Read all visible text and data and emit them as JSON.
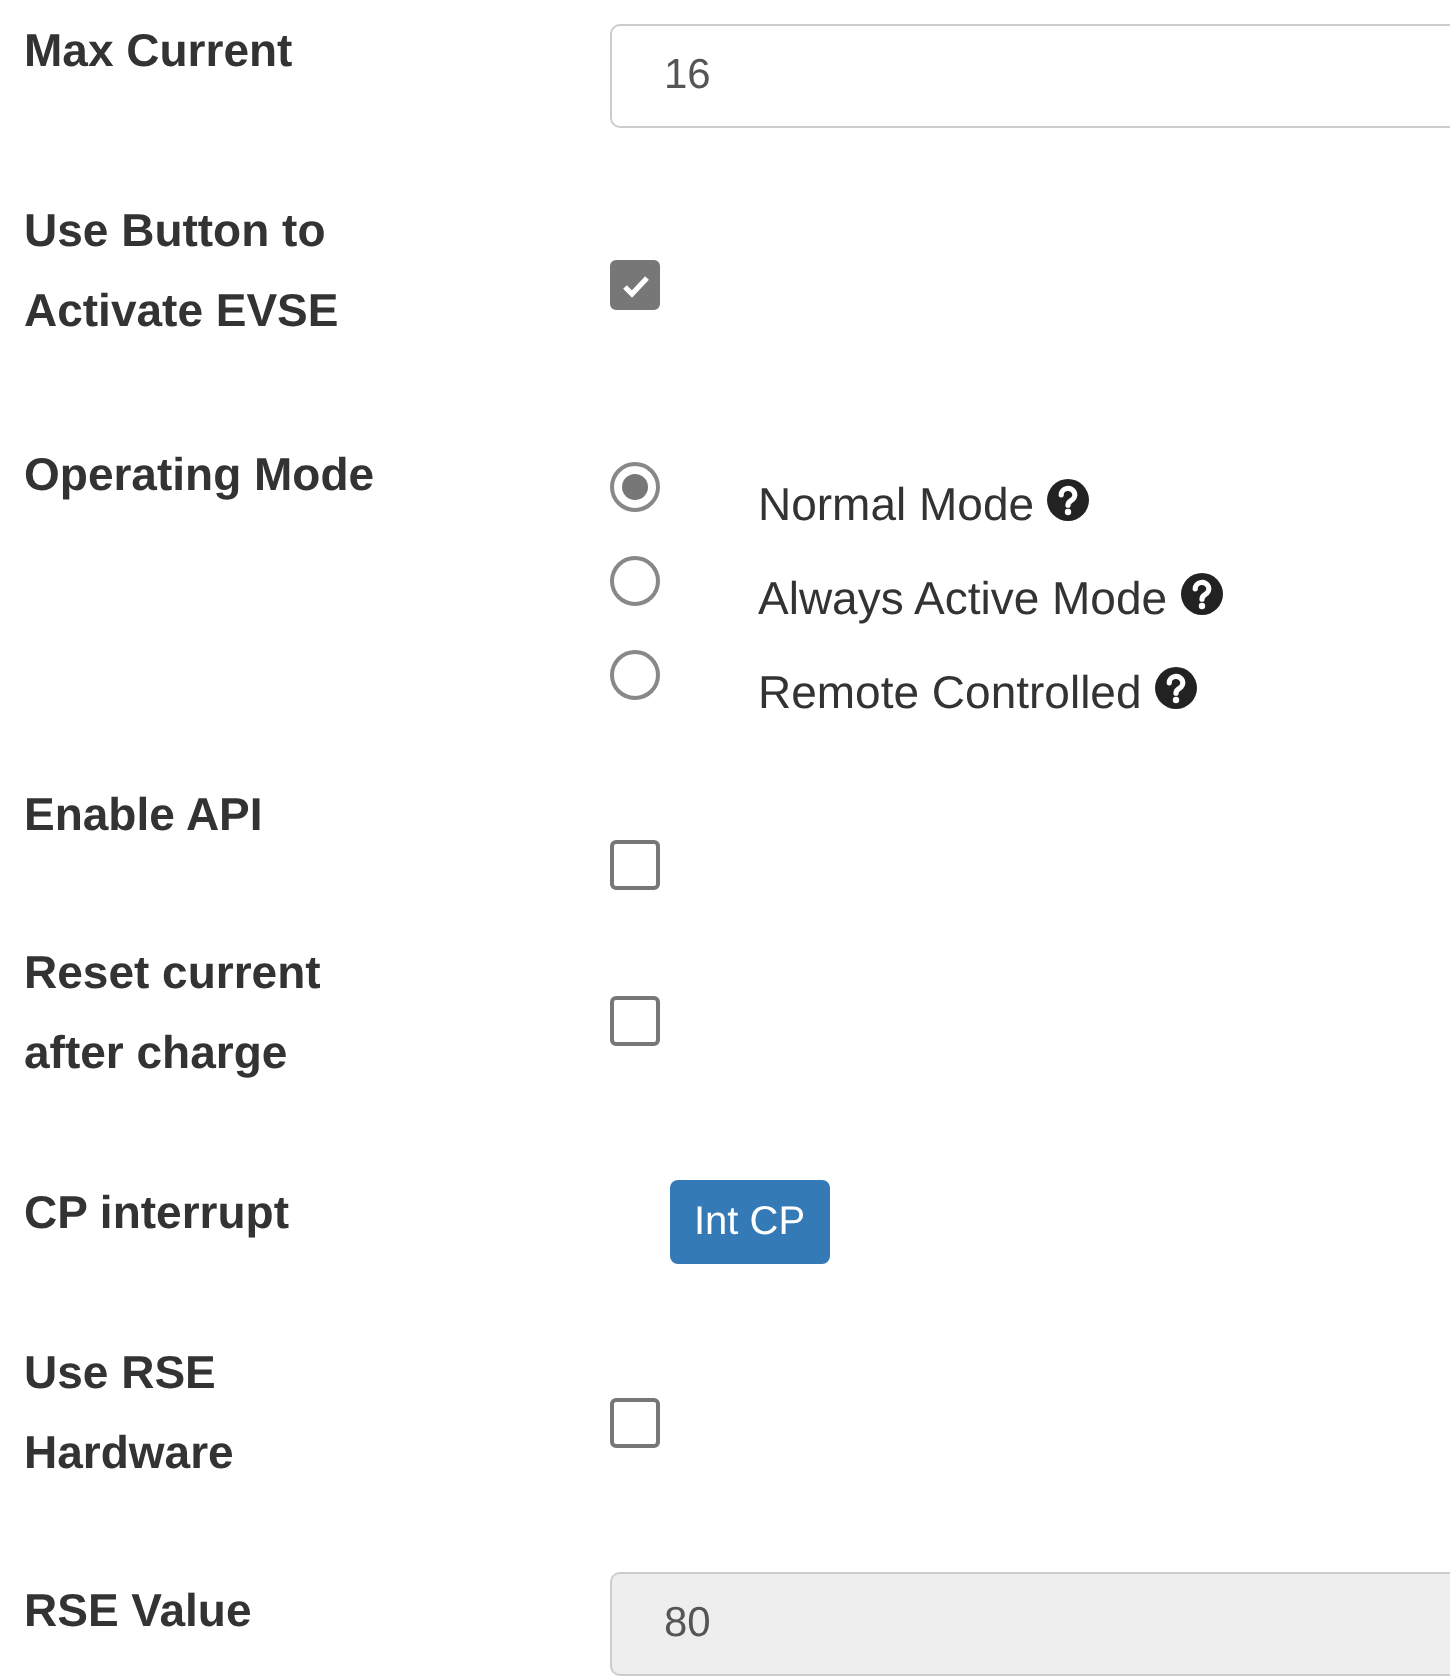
{
  "fields": [
    {
      "kind": "text_input",
      "label": "Max Current",
      "value": "16",
      "disabled": false
    },
    {
      "kind": "checkbox",
      "label": "Use Button to Activate EVSE",
      "checked": true
    },
    {
      "kind": "radio_group",
      "label": "Operating Mode",
      "options": [
        {
          "label": "Normal Mode",
          "selected": true
        },
        {
          "label": "Always Active Mode",
          "selected": false
        },
        {
          "label": "Remote Controlled",
          "selected": false
        }
      ]
    },
    {
      "kind": "checkbox",
      "label": "Enable API",
      "checked": false
    },
    {
      "kind": "checkbox",
      "label": "Reset current after charge",
      "checked": false
    },
    {
      "kind": "button",
      "label": "CP interrupt",
      "button": "Int CP"
    },
    {
      "kind": "checkbox",
      "label": "Use RSE Hardware",
      "checked": false
    },
    {
      "kind": "text_input",
      "label": "RSE Value",
      "value": "80",
      "disabled": true
    }
  ]
}
